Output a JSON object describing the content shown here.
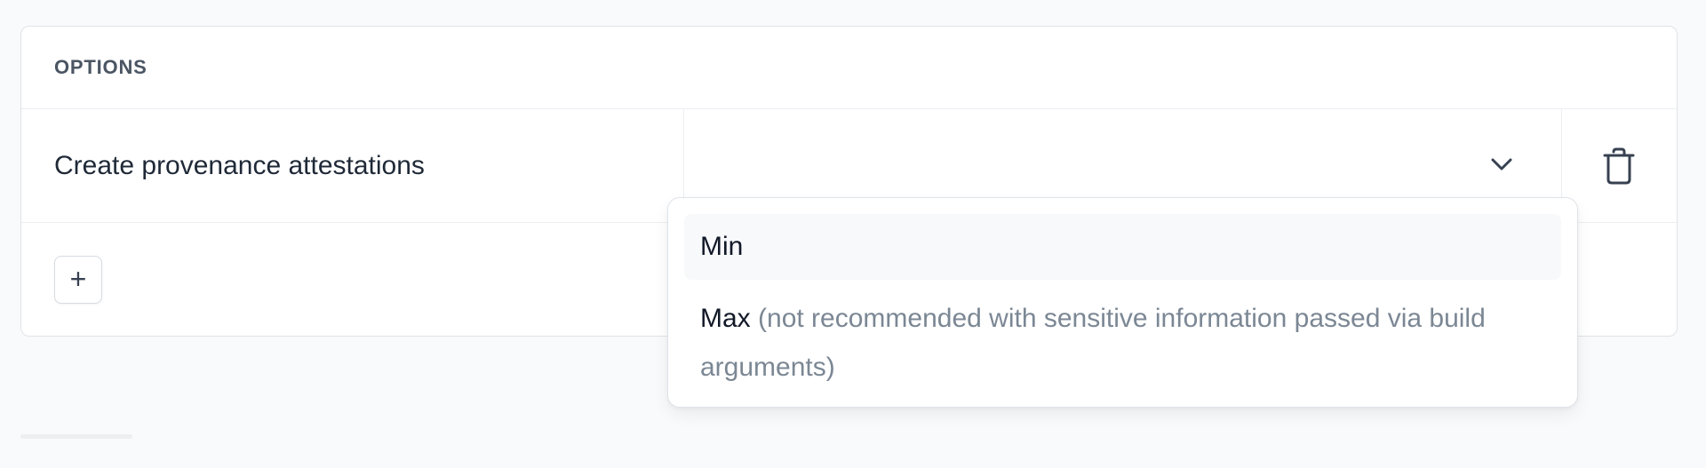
{
  "options_card": {
    "header": "OPTIONS",
    "rows": [
      {
        "label": "Create provenance attestations",
        "value": ""
      }
    ]
  },
  "dropdown": {
    "items": [
      {
        "label": "Min",
        "hint": ""
      },
      {
        "label": "Max",
        "hint": "(not recommended with sensitive information passed via build arguments)"
      }
    ]
  },
  "add_button": {
    "symbol": "+"
  },
  "icons": {
    "select_toggle": "chevron-down-icon",
    "delete": "trash-icon",
    "add": "plus-icon"
  }
}
